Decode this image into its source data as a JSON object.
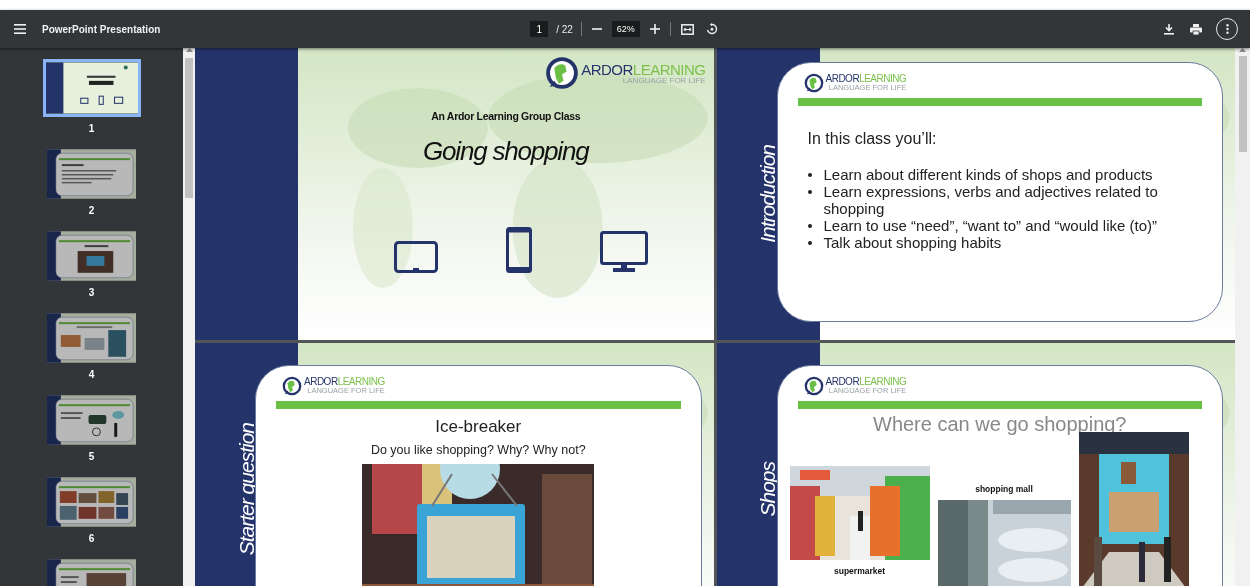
{
  "toolbar": {
    "title": "PowerPoint Presentation",
    "page": "1",
    "page_count": "/ 22",
    "zoom": "62%"
  },
  "thumbnails": [
    {
      "label": "1",
      "kind": "title",
      "selected": true
    },
    {
      "label": "2",
      "kind": "bullets",
      "selected": false
    },
    {
      "label": "3",
      "selected": false
    },
    {
      "label": "4",
      "kind": "gallery",
      "selected": false
    },
    {
      "label": "5",
      "kind": "transport",
      "selected": false
    },
    {
      "label": "6",
      "kind": "grid",
      "selected": false
    },
    {
      "kind": "photo-text",
      "selected": false
    }
  ],
  "slides": [
    {
      "kind": "title",
      "logo": {
        "word_1": "ARDOR",
        "word_2": "LEARNING",
        "tagline": "LANGUAGE FOR LIFE"
      },
      "kicker": "An Ardor Learning Group Class",
      "title": "Going shopping"
    },
    {
      "kind": "bullets",
      "side_label": "Introduction",
      "logo": {
        "word_1": "ARDOR",
        "word_2": "LEARNING",
        "tagline": "LANGUAGE FOR LIFE"
      },
      "heading": "In this class you’ll:",
      "bullets": [
        "Learn about different kinds of shops and products",
        "Learn expressions, verbs and adjectives related to shopping",
        "Learn to use “need”, “want to” and “would like (to)”",
        "Talk about shopping habits"
      ]
    },
    {
      "side_label": "Starter question",
      "logo": {
        "word_1": "ARDOR",
        "word_2": "LEARNING",
        "tagline": "LANGUAGE FOR LIFE"
      },
      "heading": "Ice-breaker",
      "question": "Do you like shopping? Why? Why not?"
    },
    {
      "kind": "gallery",
      "side_label": "Shops",
      "logo": {
        "word_1": "ARDOR",
        "word_2": "LEARNING",
        "tagline": "LANGUAGE FOR LIFE"
      },
      "heading": "Where can we go shopping?",
      "captions": [
        "supermarket",
        "shopping mall"
      ]
    }
  ]
}
